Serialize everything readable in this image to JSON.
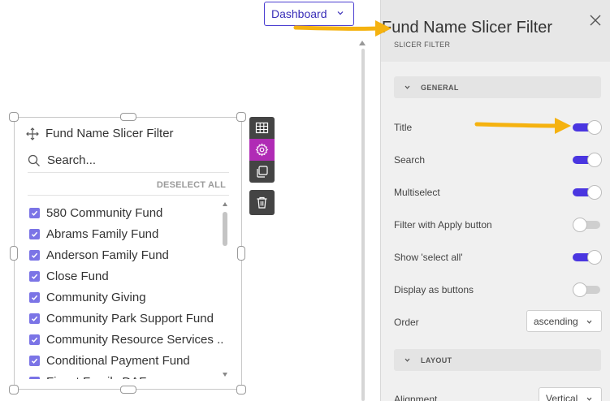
{
  "header": {
    "dashboard_label": "Dashboard"
  },
  "slicer": {
    "title": "Fund Name Slicer Filter",
    "search_placeholder": "Search...",
    "deselect_all_label": "DESELECT ALL",
    "items": [
      {
        "label": "580 Community Fund",
        "checked": true
      },
      {
        "label": "Abrams Family Fund",
        "checked": true
      },
      {
        "label": "Anderson Family Fund",
        "checked": true
      },
      {
        "label": "Close Fund",
        "checked": true
      },
      {
        "label": "Community Giving",
        "checked": true
      },
      {
        "label": "Community Park Support Fund",
        "checked": true
      },
      {
        "label": "Community Resource Services ...",
        "checked": true
      },
      {
        "label": "Conditional Payment Fund",
        "checked": true
      },
      {
        "label": "Finest Family DAF",
        "checked": true
      }
    ]
  },
  "toolbar": {
    "buttons": [
      "table-icon",
      "gear-icon",
      "copy-icon",
      "trash-icon"
    ],
    "active_color": "#b02bb5"
  },
  "panel": {
    "title": "Fund Name Slicer Filter",
    "subtitle": "SLICER FILTER",
    "sections": {
      "general": "GENERAL",
      "layout": "LAYOUT"
    },
    "options": [
      {
        "label": "Title",
        "on": true
      },
      {
        "label": "Search",
        "on": true
      },
      {
        "label": "Multiselect",
        "on": true
      },
      {
        "label": "Filter with Apply button",
        "on": false
      },
      {
        "label": "Show 'select all'",
        "on": true
      },
      {
        "label": "Display as buttons",
        "on": false
      }
    ],
    "order_label": "Order",
    "order_value": "ascending",
    "alignment_label": "Alignment",
    "alignment_value": "Vertical"
  },
  "colors": {
    "accent": "#4a36e0",
    "arrow": "#f5b20f",
    "checkbox": "#7b74e6"
  }
}
